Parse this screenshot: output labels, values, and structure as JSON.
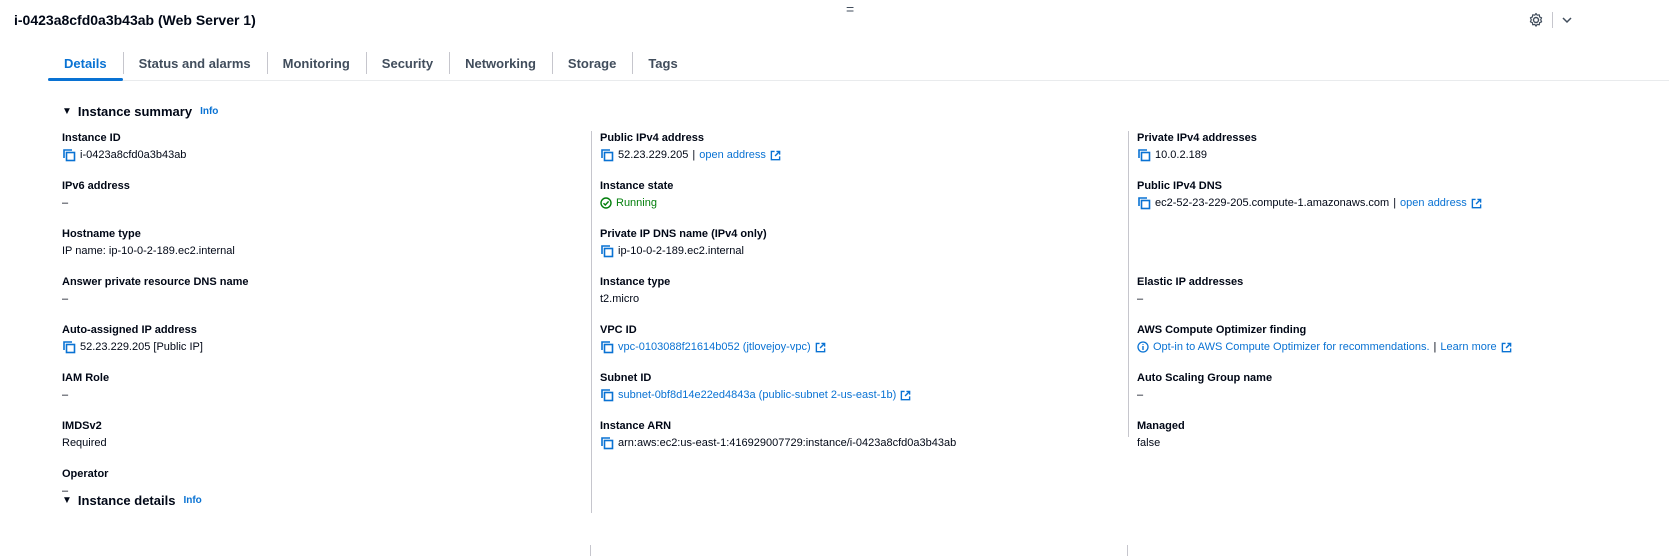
{
  "header": {
    "title": "i-0423a8cfd0a3b43ab (Web Server 1)",
    "grip": "="
  },
  "tabs": [
    "Details",
    "Status and alarms",
    "Monitoring",
    "Security",
    "Networking",
    "Storage",
    "Tags"
  ],
  "summary": {
    "title": "Instance summary",
    "info": "Info",
    "col1": [
      {
        "label": "Instance ID",
        "value": "i-0423a8cfd0a3b43ab"
      },
      {
        "label": "IPv6 address",
        "value": "–"
      },
      {
        "label": "Hostname type",
        "value": "IP name: ip-10-0-2-189.ec2.internal"
      },
      {
        "label": "Answer private resource DNS name",
        "value": "–"
      },
      {
        "label": "Auto-assigned IP address",
        "value": "52.23.229.205 [Public IP]"
      },
      {
        "label": "IAM Role",
        "value": "–"
      },
      {
        "label": "IMDSv2",
        "value": "Required"
      },
      {
        "label": "Operator",
        "value": "–"
      }
    ],
    "col2": [
      {
        "label": "Public IPv4 address",
        "value": "52.23.229.205",
        "sep": " | ",
        "link": "open address"
      },
      {
        "label": "Instance state",
        "value": "Running"
      },
      {
        "label": "Private IP DNS name (IPv4 only)",
        "value": "ip-10-0-2-189.ec2.internal"
      },
      {
        "label": "Instance type",
        "value": "t2.micro"
      },
      {
        "label": "VPC ID",
        "value": "vpc-0103088f21614b052 (jtlovejoy-vpc)"
      },
      {
        "label": "Subnet ID",
        "value": "subnet-0bf8d14e22ed4843a (public-subnet 2-us-east-1b)"
      },
      {
        "label": "Instance ARN",
        "value": "arn:aws:ec2:us-east-1:416929007729:instance/i-0423a8cfd0a3b43ab"
      }
    ],
    "col3": [
      {
        "label": "Private IPv4 addresses",
        "value": "10.0.2.189"
      },
      {
        "label": "Public IPv4 DNS",
        "value": "ec2-52-23-229-205.compute-1.amazonaws.com",
        "sep": " | ",
        "link": "open address"
      },
      {
        "label": "Elastic IP addresses",
        "value": "–"
      },
      {
        "label": "AWS Compute Optimizer finding",
        "value": "Opt-in to AWS Compute Optimizer for recommendations.",
        "sep": " | ",
        "link": "Learn more"
      },
      {
        "label": "Auto Scaling Group name",
        "value": "–"
      },
      {
        "label": "Managed",
        "value": "false"
      }
    ]
  },
  "details": {
    "title": "Instance details",
    "info": "Info"
  },
  "colors": {
    "link": "#0972d3",
    "running": "#037f0c",
    "text": "#000716",
    "divider": "#c6c6cd"
  },
  "icons": [
    "copy-icon",
    "external-link-icon",
    "status-running-icon",
    "info-circle-icon",
    "gear-icon",
    "chevron-down-icon",
    "caret-down-icon"
  ]
}
